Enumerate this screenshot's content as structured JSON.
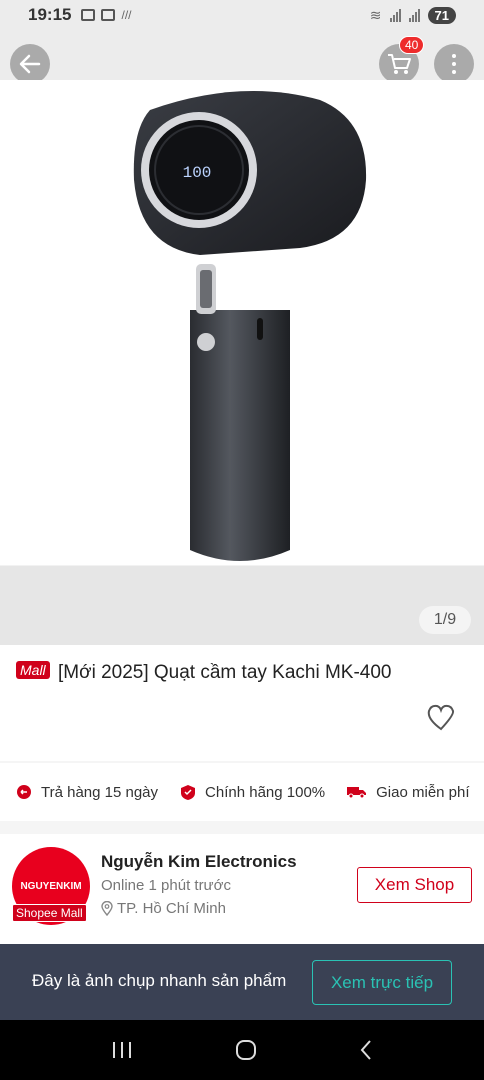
{
  "status_bar": {
    "time": "19:15",
    "battery": "71"
  },
  "nav": {
    "cart_count": "40"
  },
  "gallery": {
    "counter": "1/9",
    "display_value": "100"
  },
  "product": {
    "mall_tag": "Mall",
    "title": "[Mới 2025] Quạt cầm tay Kachi MK-400"
  },
  "badges": [
    {
      "label": "Trả hàng 15 ngày",
      "icon": "return-icon"
    },
    {
      "label": "Chính hãng 100%",
      "icon": "shield-check-icon"
    },
    {
      "label": "Giao miễn phí",
      "icon": "truck-icon"
    }
  ],
  "shop": {
    "logo_text": "NGUYENKIM",
    "mall_tag": "Shopee Mall",
    "name": "Nguyễn Kim Electronics",
    "online": "Online 1 phút trước",
    "location": "TP. Hồ Chí Minh",
    "button": "Xem Shop"
  },
  "snapshot": {
    "text": "Đây là ảnh chụp nhanh sản phẩm",
    "button": "Xem trực tiếp"
  },
  "colors": {
    "brand_red": "#d0011b",
    "teal": "#2ac2b4",
    "banner_bg": "#3a4154"
  }
}
